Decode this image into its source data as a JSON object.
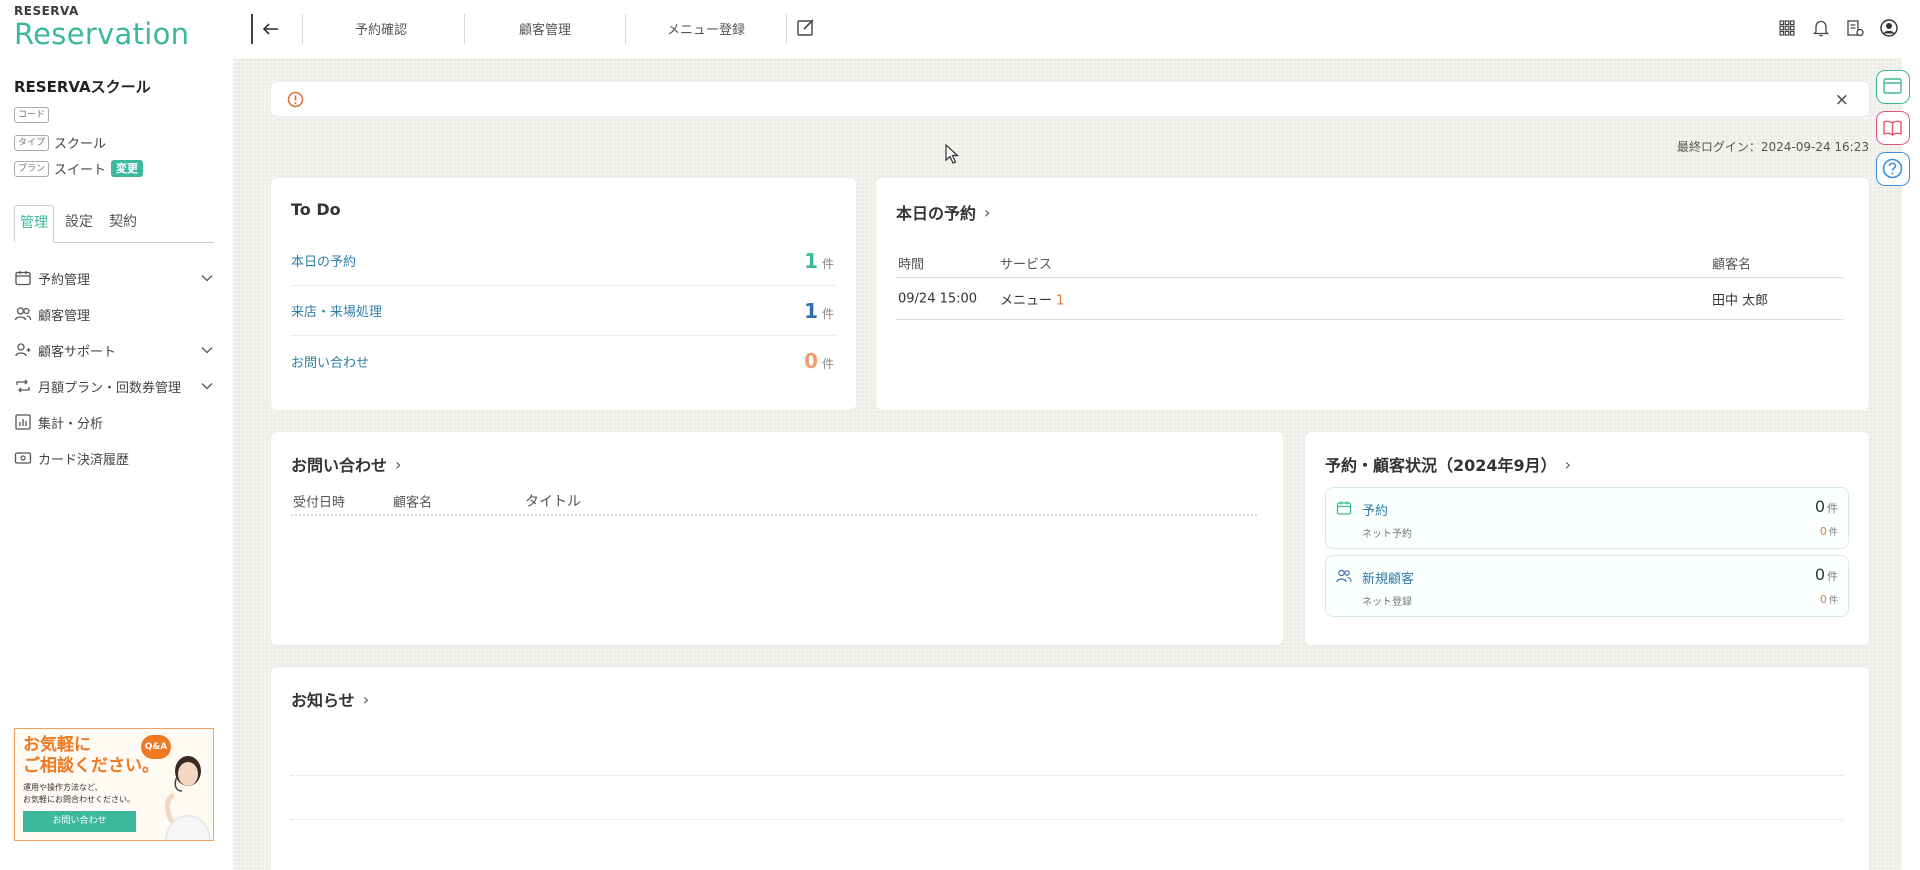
{
  "brand": {
    "small": "RESERVA",
    "large": "Reservation"
  },
  "sidebar": {
    "school_name": "RESERVAスクール",
    "meta": [
      {
        "tag": "コード",
        "value": ""
      },
      {
        "tag": "タイプ",
        "value": "スクール"
      },
      {
        "tag": "プラン",
        "value": "スイート",
        "badge": "変更"
      }
    ],
    "tabs": [
      {
        "label": "管理",
        "active": true
      },
      {
        "label": "設定"
      },
      {
        "label": "契約"
      }
    ],
    "nav": [
      {
        "label": "予約管理",
        "icon": "calendar-icon",
        "expandable": true
      },
      {
        "label": "顧客管理",
        "icon": "users-icon"
      },
      {
        "label": "顧客サポート",
        "icon": "user-plus-icon",
        "expandable": true
      },
      {
        "label": "月額プラン・回数券管理",
        "icon": "repeat-icon",
        "expandable": true
      },
      {
        "label": "集計・分析",
        "icon": "chart-icon"
      },
      {
        "label": "カード決済履歴",
        "icon": "card-icon"
      }
    ],
    "promo": {
      "title_line1": "お気軽に",
      "title_line2": "ご相談ください。",
      "sub_line1": "運用や操作方法など、",
      "sub_line2": "お気軽にお問合わせください。",
      "button": "お問い合わせ",
      "qa": "Q&A"
    }
  },
  "topbar": {
    "links": [
      "予約確認",
      "顧客管理",
      "メニュー登録"
    ]
  },
  "main": {
    "last_login": "最終ログイン：2024-09-24 16:23",
    "alert_close": "×",
    "todo": {
      "title": "To Do",
      "items": [
        {
          "label": "本日の予約",
          "value": "1",
          "unit": "件",
          "color": "#3cb89a"
        },
        {
          "label": "来店・来場処理",
          "value": "1",
          "unit": "件",
          "color": "#2f6ea8"
        },
        {
          "label": "お問い合わせ",
          "value": "0",
          "unit": "件",
          "color": "#f0a070"
        }
      ]
    },
    "today": {
      "title": "本日の予約",
      "columns": [
        "時間",
        "サービス",
        "顧客名"
      ],
      "rows": [
        {
          "time": "09/24 15:00",
          "service": "メニュー",
          "count": "1",
          "customer": "田中 太郎"
        }
      ]
    },
    "inquiry": {
      "title": "お問い合わせ",
      "columns": [
        "受付日時",
        "顧客名",
        "タイトル"
      ]
    },
    "status": {
      "title": "予約・顧客状況（2024年9月）",
      "boxes": [
        {
          "label": "予約",
          "sub": "ネット予約",
          "value": "0",
          "unit": "件",
          "subvalue": "0",
          "subunit": "件",
          "icon": "calendar-icon"
        },
        {
          "label": "新規顧客",
          "sub": "ネット登録",
          "value": "0",
          "unit": "件",
          "subvalue": "0",
          "subunit": "件",
          "icon": "users-icon"
        }
      ]
    },
    "news": {
      "title": "お知らせ"
    }
  },
  "colors": {
    "accent": "#3cb89a",
    "link": "#2f7fa8",
    "warning": "#f07820"
  }
}
